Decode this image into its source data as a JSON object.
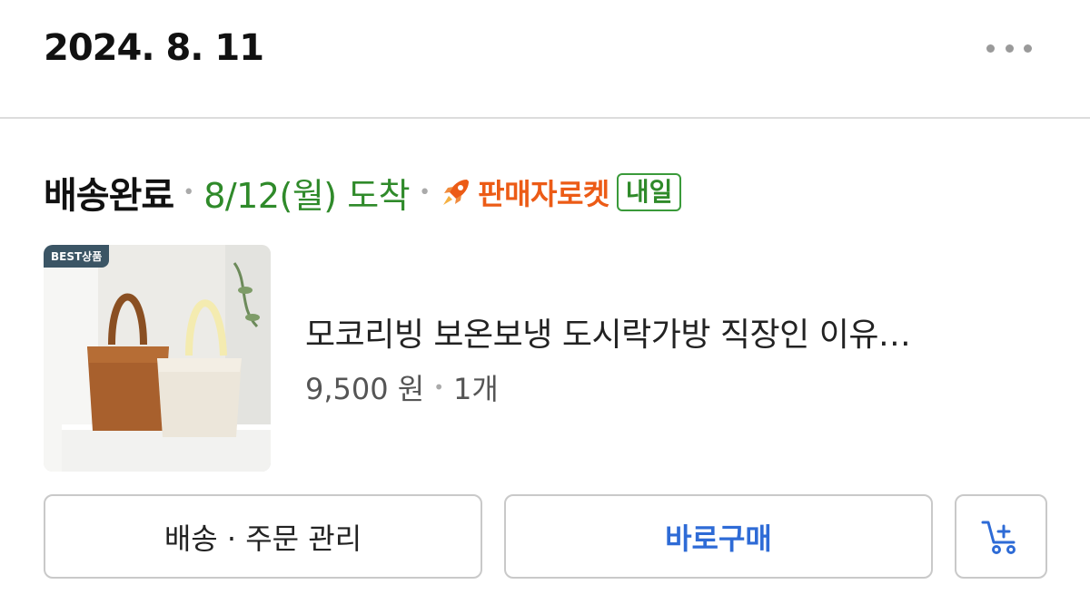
{
  "header": {
    "date": "2024. 8. 11"
  },
  "order": {
    "status": "배송완료",
    "arrival": "8/12(월) 도착",
    "rocket_label": "판매자로켓",
    "badge": "내일"
  },
  "product": {
    "best_tag": "BEST상품",
    "title": "모코리빙 보온보냉 도시락가방 직장인 이유…",
    "price": "9,500 원",
    "quantity": "1개"
  },
  "actions": {
    "manage_label": "배송 · 주문 관리",
    "buy_label": "바로구매",
    "cart_icon": "add-to-cart-icon"
  },
  "colors": {
    "arrival_green": "#2f8a2a",
    "rocket_orange": "#ec5b16",
    "buy_blue": "#2e6bd6"
  }
}
